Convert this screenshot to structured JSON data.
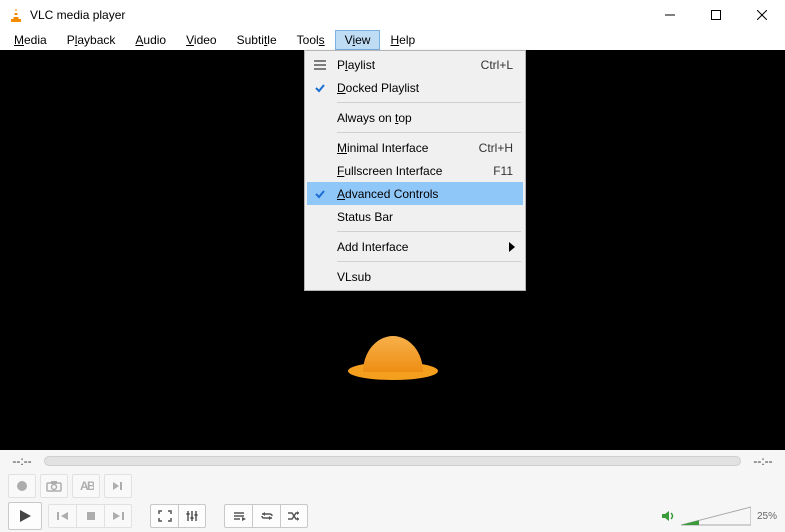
{
  "window": {
    "title": "VLC media player"
  },
  "menubar": {
    "items": [
      {
        "label": "Media",
        "mnemonic": "M"
      },
      {
        "label": "Playback",
        "mnemonic": "l"
      },
      {
        "label": "Audio",
        "mnemonic": "A"
      },
      {
        "label": "Video",
        "mnemonic": "V"
      },
      {
        "label": "Subtitle",
        "mnemonic": "S"
      },
      {
        "label": "Tools",
        "mnemonic": "T"
      },
      {
        "label": "View",
        "mnemonic": "i",
        "active": true
      },
      {
        "label": "Help",
        "mnemonic": "H"
      }
    ]
  },
  "view_menu": {
    "items": [
      {
        "label": "Playlist",
        "mnemonic": "l",
        "shortcut": "Ctrl+L",
        "icon": "playlist"
      },
      {
        "label": "Docked Playlist",
        "mnemonic": "D",
        "checked": true
      },
      {
        "sep": true
      },
      {
        "label": "Always on top",
        "mnemonic": "t"
      },
      {
        "sep": true
      },
      {
        "label": "Minimal Interface",
        "mnemonic": "M",
        "shortcut": "Ctrl+H"
      },
      {
        "label": "Fullscreen Interface",
        "mnemonic": "F",
        "shortcut": "F11"
      },
      {
        "label": "Advanced Controls",
        "mnemonic": "A",
        "checked": true,
        "highlight": true
      },
      {
        "label": "Status Bar"
      },
      {
        "sep": true
      },
      {
        "label": "Add Interface",
        "submenu": true
      },
      {
        "sep": true
      },
      {
        "label": "VLsub"
      }
    ]
  },
  "seek": {
    "left": "--:--",
    "right": "--:--"
  },
  "volume": {
    "percent": "25%"
  },
  "advanced_controls": {
    "buttons": [
      "record",
      "snapshot",
      "loop-ab",
      "frame-step"
    ]
  },
  "main_controls": {
    "play": "play",
    "prev": "prev",
    "stop": "stop",
    "next": "next",
    "fullscreen": "fullscreen",
    "ext": "extended-settings",
    "playlist": "playlist",
    "loop": "loop",
    "shuffle": "shuffle"
  }
}
